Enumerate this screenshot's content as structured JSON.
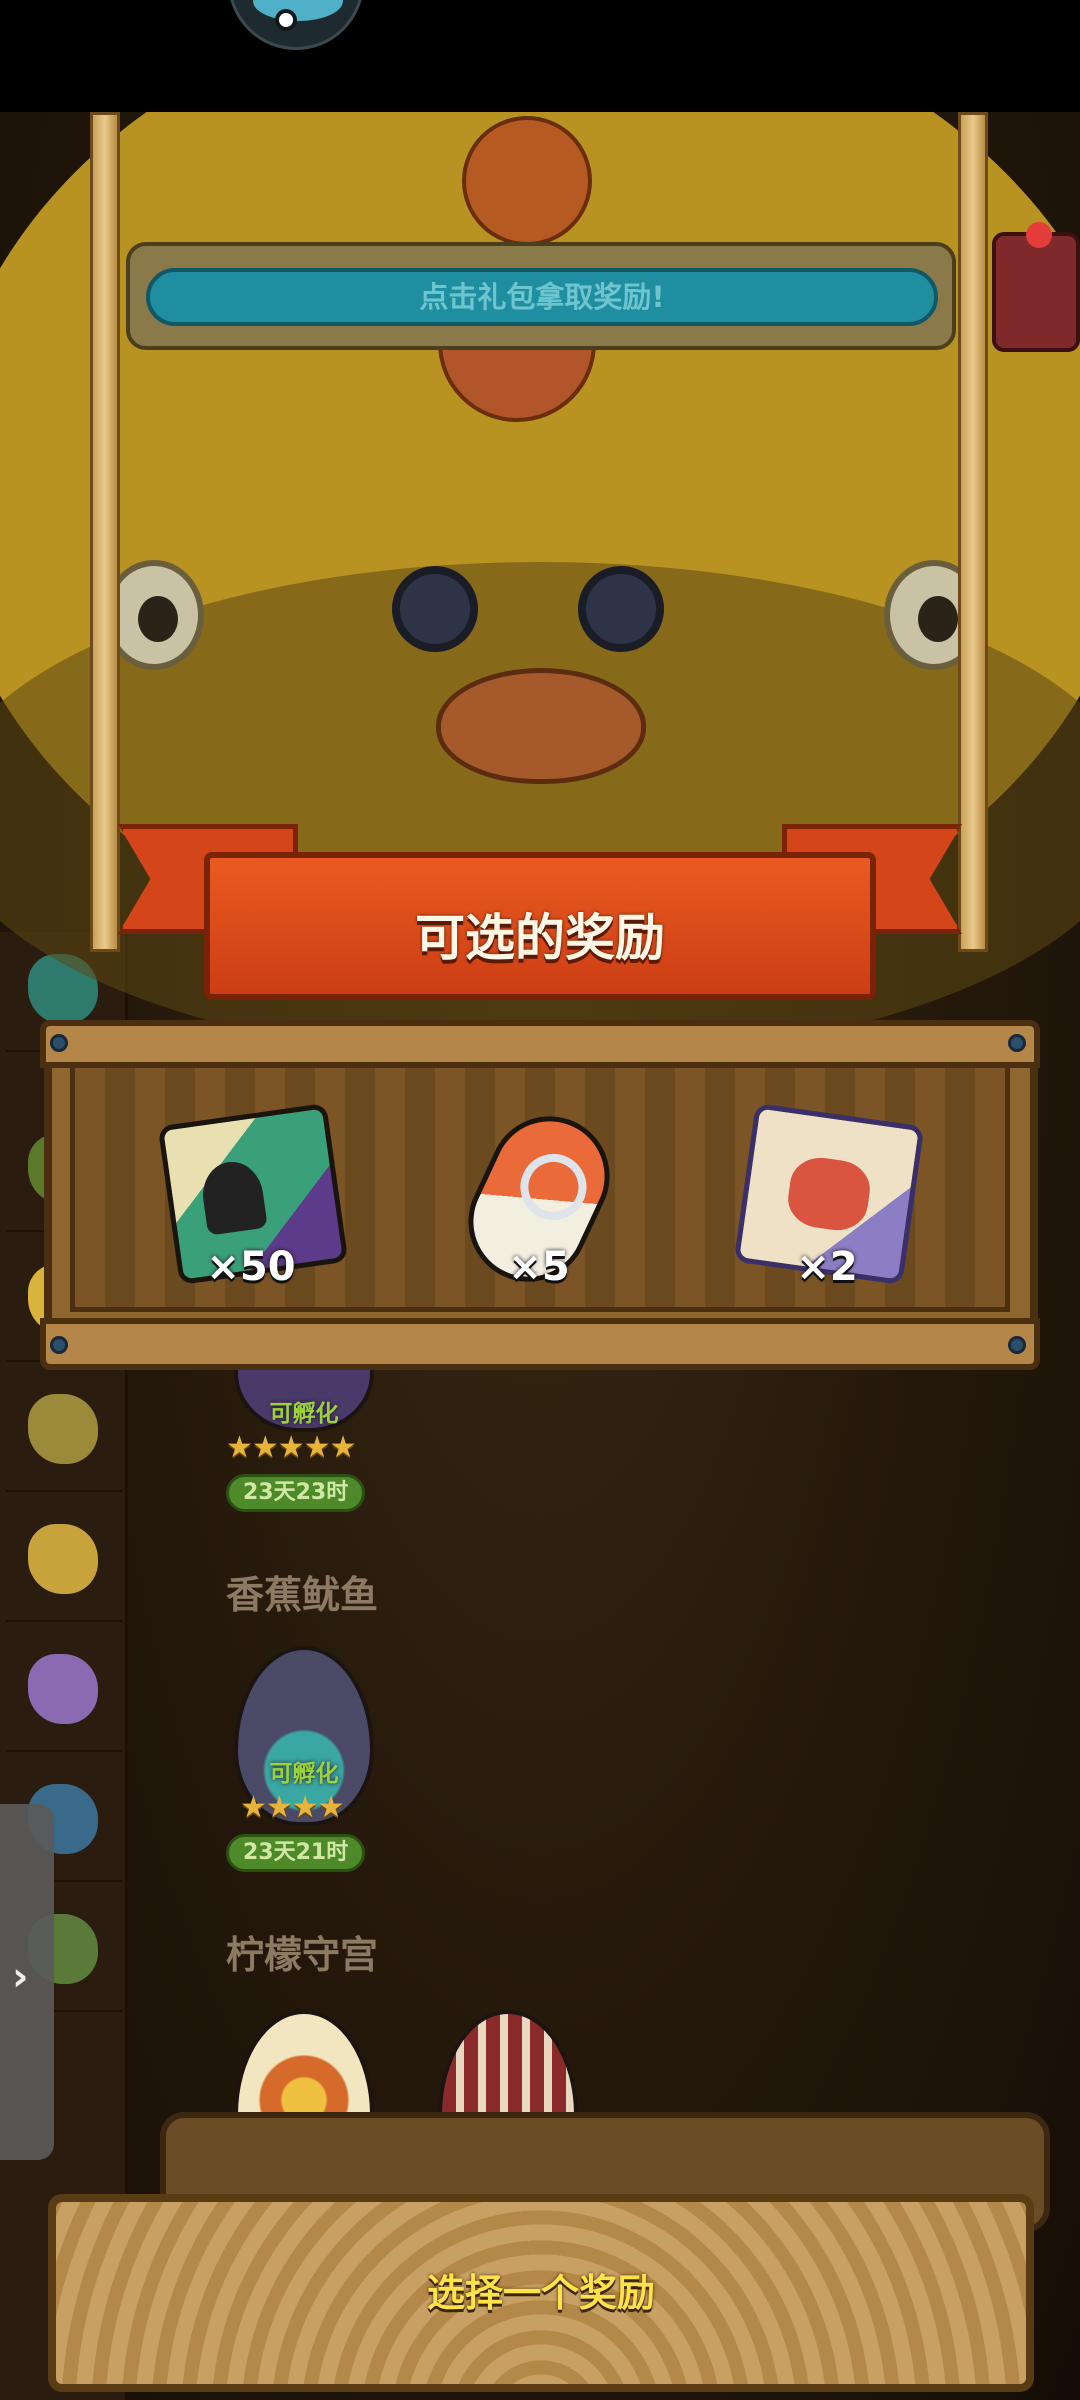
{
  "hint": {
    "text": "点击礼包拿取奖励!"
  },
  "panel": {
    "title": "可选的奖励"
  },
  "rewards": [
    {
      "icon": "ticket-pack-icon",
      "quantity": "×50"
    },
    {
      "icon": "capsule-key-icon",
      "quantity": "×5"
    },
    {
      "icon": "recipe-scroll-icon",
      "quantity": "×2"
    }
  ],
  "eggs": [
    {
      "status": "可孵化",
      "stars": "★★★★★",
      "timer": "23天23时"
    },
    {
      "name": "香蕉鱿鱼",
      "status": "可孵化",
      "stars": "★★★★",
      "timer": "23天21时"
    },
    {
      "name": "柠檬守宫"
    }
  ],
  "sidebar": {
    "toggle": "›"
  },
  "footer": {
    "button_label": "选择一个奖励"
  },
  "colors": {
    "ribbon": "#d4461a",
    "button_text": "#ffe14a",
    "hint_bar": "#1f8ea1"
  }
}
